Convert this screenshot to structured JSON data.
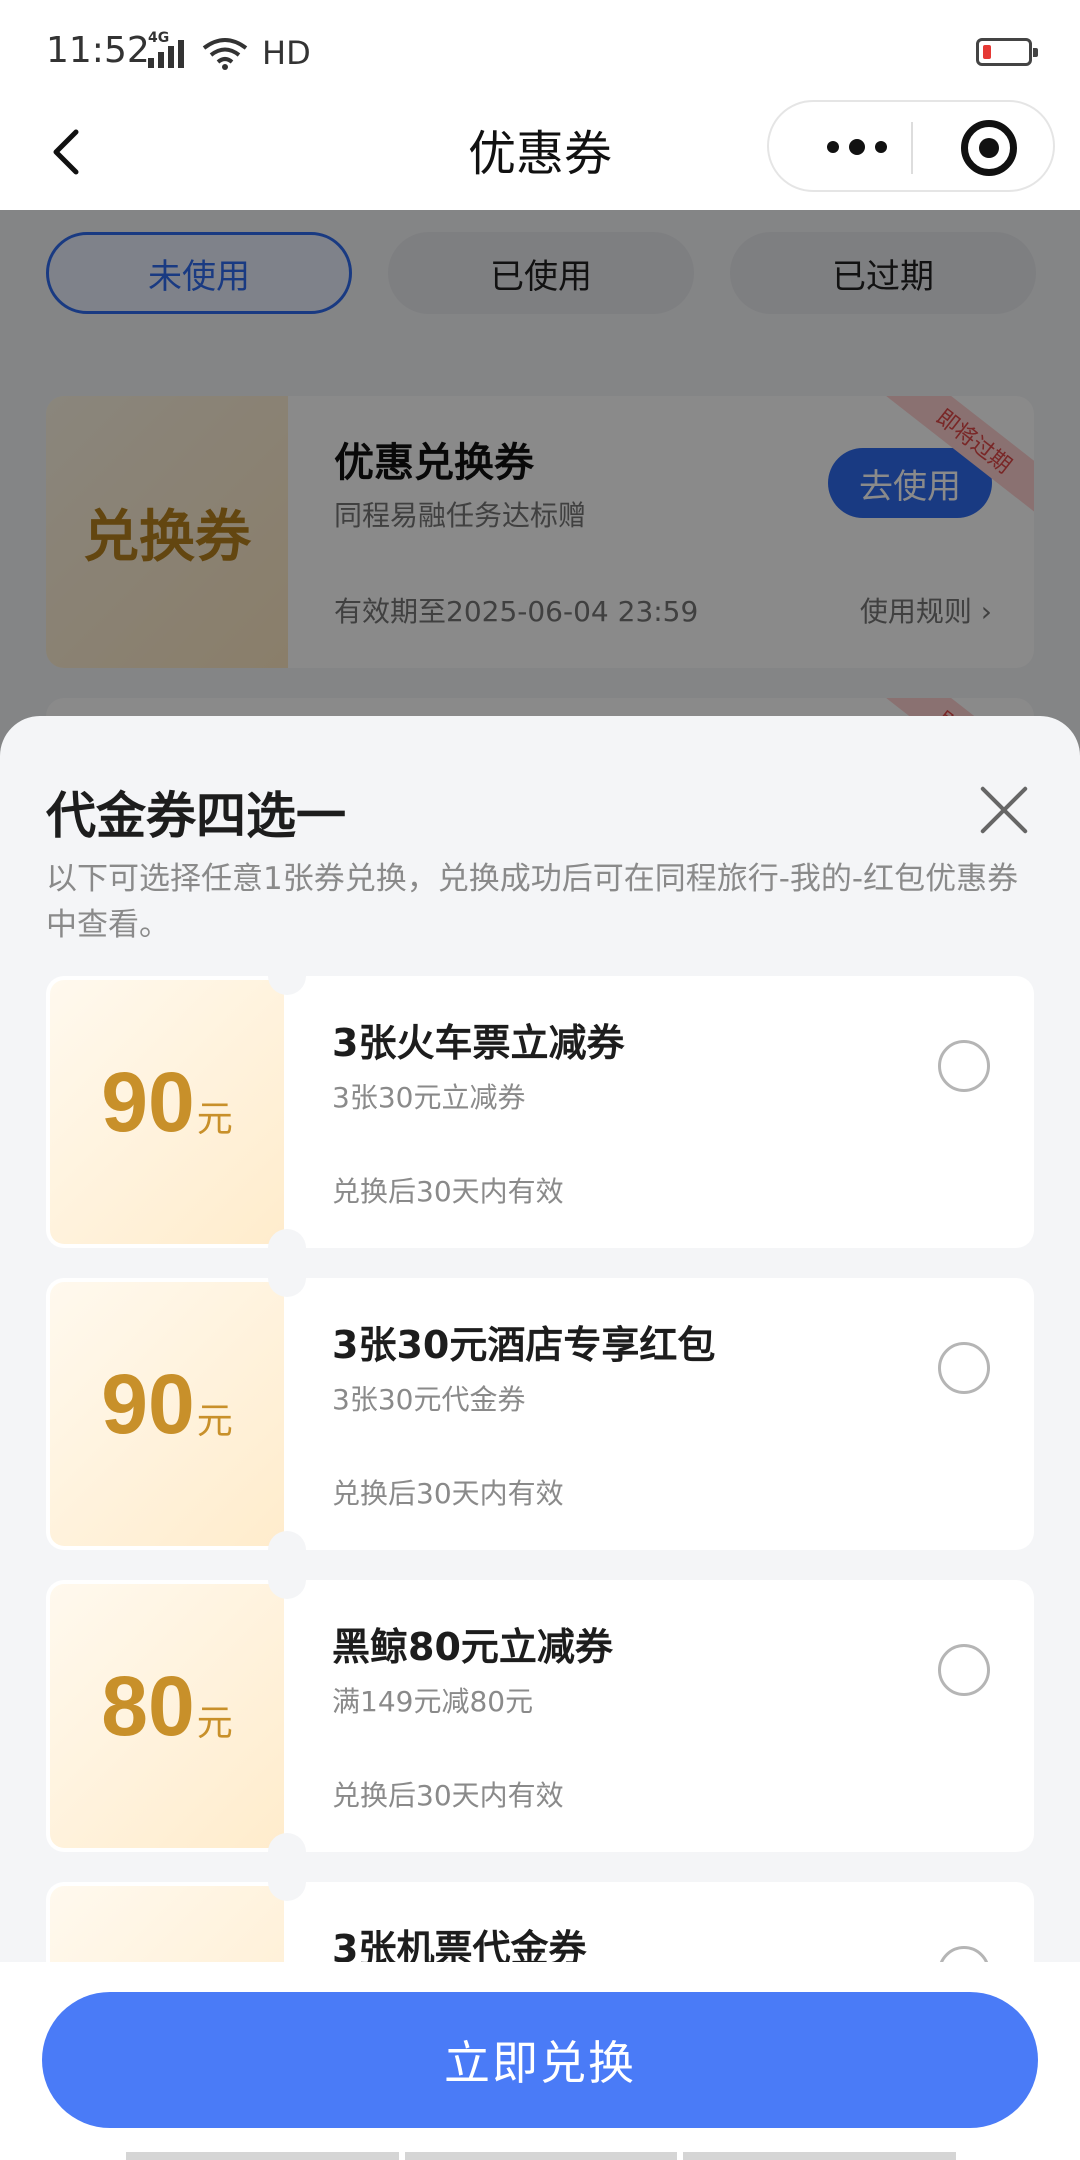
{
  "status_bar": {
    "time": "11:52",
    "network": "4G",
    "hd": "HD"
  },
  "nav": {
    "title": "优惠券"
  },
  "tabs": [
    {
      "label": "未使用",
      "active": true
    },
    {
      "label": "已使用",
      "active": false
    },
    {
      "label": "已过期",
      "active": false
    }
  ],
  "bg_card": {
    "left_label": "兑换券",
    "title": "优惠兑换券",
    "subtitle": "同程易融任务达标赠",
    "expiry": "有效期至2025-06-04 23:59",
    "rules": "使用规则 ›",
    "use_button": "去使用",
    "ribbon": "即将过期"
  },
  "sheet": {
    "title": "代金券四选一",
    "description": "以下可选择任意1张券兑换，兑换成功后可在同程旅行-我的-红包优惠券中查看。",
    "coupons": [
      {
        "amount": "90",
        "unit": "元",
        "title": "3张火车票立减券",
        "subtitle": "3张30元立减券",
        "validity": "兑换后30天内有效"
      },
      {
        "amount": "90",
        "unit": "元",
        "title": "3张30元酒店专享红包",
        "subtitle": "3张30元代金券",
        "validity": "兑换后30天内有效"
      },
      {
        "amount": "80",
        "unit": "元",
        "title": "黑鲸80元立减券",
        "subtitle": "满149元减80元",
        "validity": "兑换后30天内有效"
      },
      {
        "amount": "",
        "unit": "",
        "title": "3张机票代金券",
        "subtitle": "",
        "validity": ""
      }
    ]
  },
  "footer": {
    "redeem_label": "立即兑换"
  },
  "colors": {
    "accent": "#4a7bf7",
    "gold": "#c8902a",
    "tab_active": "#2f6bf0"
  }
}
